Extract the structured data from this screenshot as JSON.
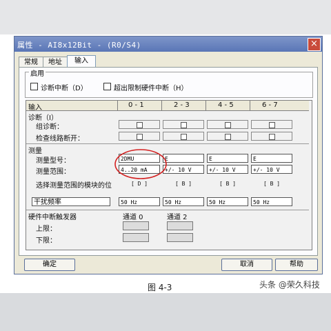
{
  "window": {
    "title": "属性 - AI8x12Bit - (R0/S4)",
    "close_glyph": "×"
  },
  "tabs": [
    "常规",
    "地址",
    "输入"
  ],
  "enable": {
    "label": "启用",
    "diag_interrupt": "诊断中断（D）",
    "limit_interrupt": "超出限制硬件中断（H）"
  },
  "grid": {
    "header": [
      "输入",
      "0 - 1",
      "2 - 3",
      "4 - 5",
      "6 - 7"
    ],
    "diagnosis": {
      "label": "诊断（I）",
      "group_diag": "组诊断：",
      "wire_break": "检查线路断开："
    },
    "measure": {
      "label": "测量",
      "type_label": "测量型号：",
      "range_label": "测量范围：",
      "module_pos_label": "选择测量范围的模块的位",
      "interference_label": "干扰频率",
      "types": [
        "2DMU",
        "E",
        "E",
        "E"
      ],
      "ranges": [
        "4..20 mA",
        "+/- 10 V",
        "+/- 10 V",
        "+/- 10 V"
      ],
      "module_pos": [
        "[ D ]",
        "[ B ]",
        "[ B ]",
        "[ B ]"
      ],
      "interference": [
        "50 Hz",
        "50 Hz",
        "50 Hz",
        "50 Hz"
      ]
    },
    "hw_interrupt": {
      "label": "硬件中断触发器",
      "channel0": "通道 0",
      "channel2": "通道 2",
      "upper": "上限：",
      "lower": "下限："
    }
  },
  "buttons": {
    "ok": "确定",
    "cancel": "取消",
    "help": "帮助"
  },
  "annotation_color": "#d42020",
  "caption": "图 4-3",
  "watermark": "头条 @荣久科技"
}
